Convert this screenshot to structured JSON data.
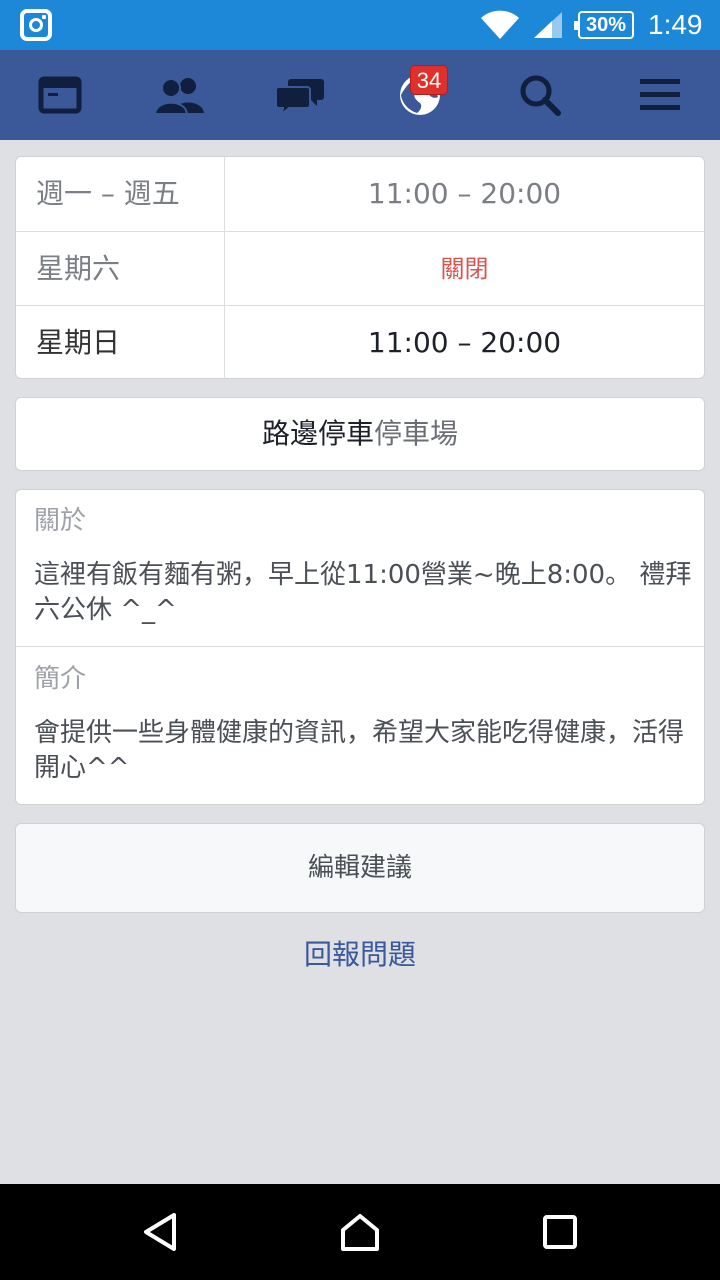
{
  "status_bar": {
    "battery": "30%",
    "time": "1:49",
    "icons": [
      "instagram-icon",
      "wifi-icon",
      "signal-icon",
      "battery-icon"
    ]
  },
  "nav": {
    "items": [
      {
        "icon": "news-feed-icon"
      },
      {
        "icon": "friends-icon"
      },
      {
        "icon": "messages-icon"
      },
      {
        "icon": "notifications-globe-icon",
        "badge": "34"
      },
      {
        "icon": "search-icon"
      },
      {
        "icon": "menu-icon"
      }
    ],
    "bar_color": "#3b5998",
    "badge_color": "#e0302c"
  },
  "hours": [
    {
      "day": "週一 – 週五",
      "time": "11:00 – 20:00"
    },
    {
      "day": "星期六",
      "time": "關閉"
    },
    {
      "day": "星期日",
      "time": "11:00 – 20:00"
    }
  ],
  "parking": {
    "primary": "路邊停車",
    "secondary": "停車場"
  },
  "about": {
    "about_label": "關於",
    "about_text": "這裡有飯有麵有粥，早上從11:00營業~晚上8:00。 禮拜六公休 ^_^",
    "intro_label": "簡介",
    "intro_text": "會提供一些身體健康的資訊，希望大家能吃得健康，活得開心^^"
  },
  "actions": {
    "edit_suggestion": "編輯建議",
    "report_problem": "回報問題"
  },
  "system_nav": {
    "icons": [
      "back-icon",
      "home-icon",
      "recents-icon"
    ]
  }
}
